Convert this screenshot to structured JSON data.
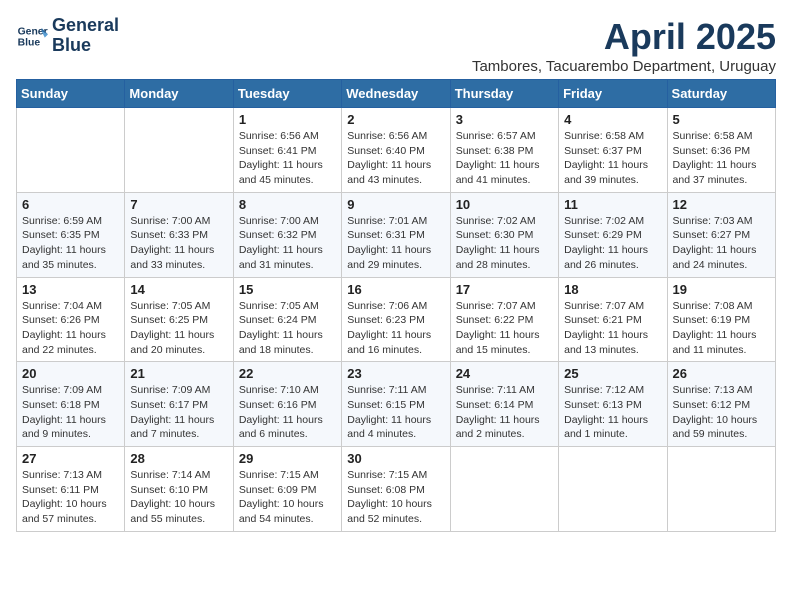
{
  "logo": {
    "line1": "General",
    "line2": "Blue"
  },
  "title": "April 2025",
  "subtitle": "Tambores, Tacuarembo Department, Uruguay",
  "days_of_week": [
    "Sunday",
    "Monday",
    "Tuesday",
    "Wednesday",
    "Thursday",
    "Friday",
    "Saturday"
  ],
  "weeks": [
    [
      {
        "day": "",
        "info": ""
      },
      {
        "day": "",
        "info": ""
      },
      {
        "day": "1",
        "info": "Sunrise: 6:56 AM\nSunset: 6:41 PM\nDaylight: 11 hours and 45 minutes."
      },
      {
        "day": "2",
        "info": "Sunrise: 6:56 AM\nSunset: 6:40 PM\nDaylight: 11 hours and 43 minutes."
      },
      {
        "day": "3",
        "info": "Sunrise: 6:57 AM\nSunset: 6:38 PM\nDaylight: 11 hours and 41 minutes."
      },
      {
        "day": "4",
        "info": "Sunrise: 6:58 AM\nSunset: 6:37 PM\nDaylight: 11 hours and 39 minutes."
      },
      {
        "day": "5",
        "info": "Sunrise: 6:58 AM\nSunset: 6:36 PM\nDaylight: 11 hours and 37 minutes."
      }
    ],
    [
      {
        "day": "6",
        "info": "Sunrise: 6:59 AM\nSunset: 6:35 PM\nDaylight: 11 hours and 35 minutes."
      },
      {
        "day": "7",
        "info": "Sunrise: 7:00 AM\nSunset: 6:33 PM\nDaylight: 11 hours and 33 minutes."
      },
      {
        "day": "8",
        "info": "Sunrise: 7:00 AM\nSunset: 6:32 PM\nDaylight: 11 hours and 31 minutes."
      },
      {
        "day": "9",
        "info": "Sunrise: 7:01 AM\nSunset: 6:31 PM\nDaylight: 11 hours and 29 minutes."
      },
      {
        "day": "10",
        "info": "Sunrise: 7:02 AM\nSunset: 6:30 PM\nDaylight: 11 hours and 28 minutes."
      },
      {
        "day": "11",
        "info": "Sunrise: 7:02 AM\nSunset: 6:29 PM\nDaylight: 11 hours and 26 minutes."
      },
      {
        "day": "12",
        "info": "Sunrise: 7:03 AM\nSunset: 6:27 PM\nDaylight: 11 hours and 24 minutes."
      }
    ],
    [
      {
        "day": "13",
        "info": "Sunrise: 7:04 AM\nSunset: 6:26 PM\nDaylight: 11 hours and 22 minutes."
      },
      {
        "day": "14",
        "info": "Sunrise: 7:05 AM\nSunset: 6:25 PM\nDaylight: 11 hours and 20 minutes."
      },
      {
        "day": "15",
        "info": "Sunrise: 7:05 AM\nSunset: 6:24 PM\nDaylight: 11 hours and 18 minutes."
      },
      {
        "day": "16",
        "info": "Sunrise: 7:06 AM\nSunset: 6:23 PM\nDaylight: 11 hours and 16 minutes."
      },
      {
        "day": "17",
        "info": "Sunrise: 7:07 AM\nSunset: 6:22 PM\nDaylight: 11 hours and 15 minutes."
      },
      {
        "day": "18",
        "info": "Sunrise: 7:07 AM\nSunset: 6:21 PM\nDaylight: 11 hours and 13 minutes."
      },
      {
        "day": "19",
        "info": "Sunrise: 7:08 AM\nSunset: 6:19 PM\nDaylight: 11 hours and 11 minutes."
      }
    ],
    [
      {
        "day": "20",
        "info": "Sunrise: 7:09 AM\nSunset: 6:18 PM\nDaylight: 11 hours and 9 minutes."
      },
      {
        "day": "21",
        "info": "Sunrise: 7:09 AM\nSunset: 6:17 PM\nDaylight: 11 hours and 7 minutes."
      },
      {
        "day": "22",
        "info": "Sunrise: 7:10 AM\nSunset: 6:16 PM\nDaylight: 11 hours and 6 minutes."
      },
      {
        "day": "23",
        "info": "Sunrise: 7:11 AM\nSunset: 6:15 PM\nDaylight: 11 hours and 4 minutes."
      },
      {
        "day": "24",
        "info": "Sunrise: 7:11 AM\nSunset: 6:14 PM\nDaylight: 11 hours and 2 minutes."
      },
      {
        "day": "25",
        "info": "Sunrise: 7:12 AM\nSunset: 6:13 PM\nDaylight: 11 hours and 1 minute."
      },
      {
        "day": "26",
        "info": "Sunrise: 7:13 AM\nSunset: 6:12 PM\nDaylight: 10 hours and 59 minutes."
      }
    ],
    [
      {
        "day": "27",
        "info": "Sunrise: 7:13 AM\nSunset: 6:11 PM\nDaylight: 10 hours and 57 minutes."
      },
      {
        "day": "28",
        "info": "Sunrise: 7:14 AM\nSunset: 6:10 PM\nDaylight: 10 hours and 55 minutes."
      },
      {
        "day": "29",
        "info": "Sunrise: 7:15 AM\nSunset: 6:09 PM\nDaylight: 10 hours and 54 minutes."
      },
      {
        "day": "30",
        "info": "Sunrise: 7:15 AM\nSunset: 6:08 PM\nDaylight: 10 hours and 52 minutes."
      },
      {
        "day": "",
        "info": ""
      },
      {
        "day": "",
        "info": ""
      },
      {
        "day": "",
        "info": ""
      }
    ]
  ]
}
